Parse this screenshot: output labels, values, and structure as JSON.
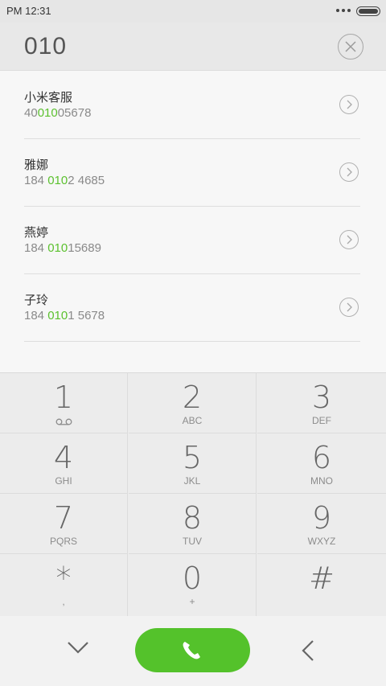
{
  "status_bar": {
    "time": "PM 12:31"
  },
  "dial_entry": {
    "number": "010"
  },
  "results": [
    {
      "name": "小米客服",
      "pre": "40",
      "match": "010",
      "post": "05678"
    },
    {
      "name": "雅娜",
      "pre": "184 ",
      "match": "010",
      "post": "2 4685"
    },
    {
      "name": "燕婷",
      "pre": "184 ",
      "match": "010",
      "post": "15689"
    },
    {
      "name": "子玲",
      "pre": "184 ",
      "match": "010",
      "post": "1 5678"
    }
  ],
  "keypad": [
    {
      "digit": "1",
      "letters": ""
    },
    {
      "digit": "2",
      "letters": "ABC"
    },
    {
      "digit": "3",
      "letters": "DEF"
    },
    {
      "digit": "4",
      "letters": "GHI"
    },
    {
      "digit": "5",
      "letters": "JKL"
    },
    {
      "digit": "6",
      "letters": "MNO"
    },
    {
      "digit": "7",
      "letters": "PQRS"
    },
    {
      "digit": "8",
      "letters": "TUV"
    },
    {
      "digit": "9",
      "letters": "WXYZ"
    },
    {
      "digit": "*",
      "letters": ","
    },
    {
      "digit": "0",
      "letters": "+"
    },
    {
      "digit": "#",
      "letters": ""
    }
  ],
  "colors": {
    "accent_green": "#54c22b",
    "match_highlight": "#5cc12f"
  },
  "icons": {
    "key1_sub": "voicemail-icon",
    "clear": "close-circle-icon",
    "call": "phone-icon",
    "collapse": "chevron-down-icon",
    "back": "backspace-chevron-icon"
  }
}
